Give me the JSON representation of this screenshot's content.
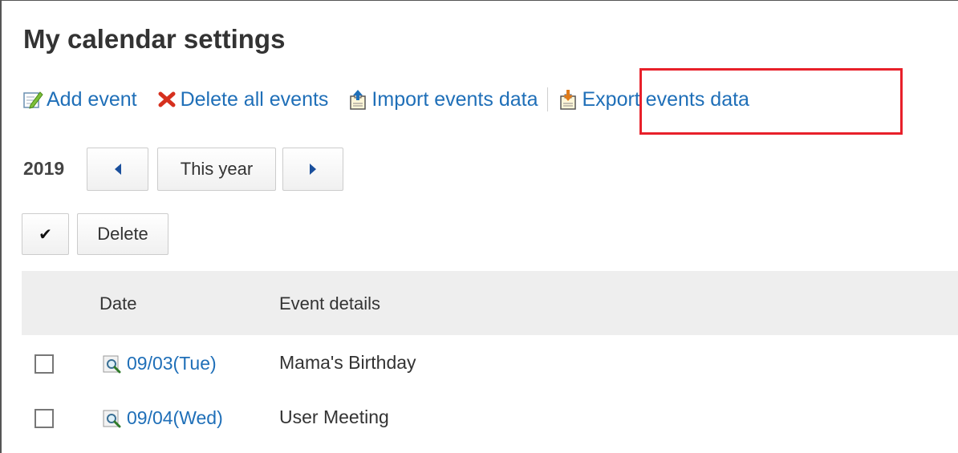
{
  "page": {
    "title": "My calendar settings"
  },
  "toolbar": {
    "add_event": "Add event",
    "delete_all": "Delete all events",
    "import": "Import events data",
    "export": "Export events data"
  },
  "year_nav": {
    "year": "2019",
    "this_year": "This year"
  },
  "actions": {
    "delete": "Delete",
    "check_all_symbol": "✔"
  },
  "table": {
    "headers": {
      "date": "Date",
      "event": "Event details"
    },
    "rows": [
      {
        "date": "09/03(Tue)",
        "event": "Mama's Birthday"
      },
      {
        "date": "09/04(Wed)",
        "event": "User Meeting"
      }
    ]
  },
  "colors": {
    "link": "#1f6fb8",
    "highlight": "#e8202a",
    "header_bg": "#eeeeee"
  }
}
